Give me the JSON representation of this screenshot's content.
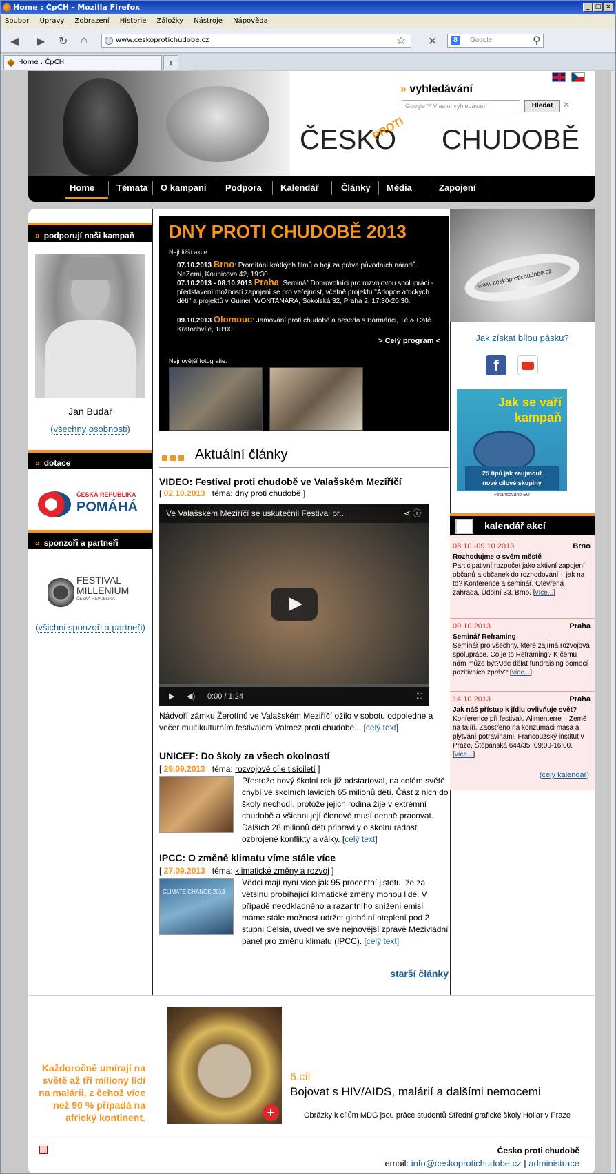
{
  "browser": {
    "title": "Home : ČpCH - Mozilla Firefox",
    "menu": [
      "Soubor",
      "Úpravy",
      "Zobrazení",
      "Historie",
      "Záložky",
      "Nástroje",
      "Nápověda"
    ],
    "url": "www.ceskoprotichudobe.cz",
    "search_placeholder": "Google",
    "tab_label": "Home : ČpCH",
    "newtab": "+"
  },
  "header": {
    "search_title": "vyhledávání",
    "search_placeholder": "Google™ Vlastní vyhledávání",
    "search_button": "Hledat",
    "logo_left": "ČESKO",
    "logo_mid": "PROTI",
    "logo_right": "CHUDOBĚ"
  },
  "nav": [
    "Home",
    "Témata",
    "O kampani",
    "Podpora",
    "Kalendář",
    "Články",
    "Média",
    "Zapojení"
  ],
  "left": {
    "support_title": "podporují naši kampaň",
    "person_name": "Jan Budař",
    "all_persons": "všechny osobnosti",
    "dotace_title": "dotace",
    "pomaha_top": "ČESKÁ REPUBLIKA",
    "pomaha_bottom": "POMÁHÁ",
    "sponsors_title": "sponzoři a partneři",
    "millenium_name": "FESTIVAL MILLENIUM",
    "millenium_sub": "ČESKÁ REPUBLIKA",
    "all_sponsors": "všichni sponzoři a partneři"
  },
  "promo": {
    "title": "DNY PROTI CHUDOBĚ 2013",
    "nearest": "Nejbližší akce:",
    "events": [
      {
        "date": "07.10.2013",
        "city": "Brno",
        "text": ": Promítání krátkých filmů o boji za práva původních národů. NaZemi, Kounicova 42, 19:30."
      },
      {
        "date": "07.10.2013 - 08.10.2013",
        "city": "Praha",
        "text": ": Seminář Dobrovolníci pro rozvojovou spolupráci - představení možností zapojení se pro veřejnost, včetně projektu \"Adopce afrických dětí\" a projektů v Guinei. WONTANARA, Sokolská 32, Praha 2, 17:30-20:30."
      },
      {
        "date": "09.10.2013",
        "city": "Olomouc",
        "text": ": Jamování proti chudobě a beseda s Barmánci, Té & Café Kratochvíle, 18:00."
      }
    ],
    "program": "> Celý program <",
    "photos": "Nejnovější fotografie:"
  },
  "articles": {
    "section": "Aktuální články",
    "items": [
      {
        "title": "VIDEO: Festival proti chudobě ve Valašském Meziříčí",
        "date": "02.10.2013",
        "topic_label": "téma:",
        "topic": "dny proti chudobě",
        "video_title": "Ve Valašském Meziříčí se uskutečnil Festival pr...",
        "video_time": "0:00 / 1:24",
        "text": "Nádvoří zámku Žerotínů ve Valašském Meziříčí ožilo v sobotu odpoledne a večer multikulturním festivalem Valmez proti chudobě...",
        "more": "celý text"
      },
      {
        "title": "UNICEF: Do školy za všech okolností",
        "date": "29.09.2013",
        "topic_label": "téma:",
        "topic": "rozvojové cíle tisíciletí",
        "text": "Přestože nový školní rok již odstartoval, na celém světě chybí ve školních lavicích 65 milionů dětí. Část z nich do školy nechodí, protože jejich rodina žije v extrémní chudobě a všichni její členové musí denně pracovat. Dalších 28 milionů dětí připravily o školní radosti ozbrojené konflikty a války.",
        "more": "celý text"
      },
      {
        "title": "IPCC: O změně klimatu víme stále více",
        "date": "27.09.2013",
        "topic_label": "téma:",
        "topic": "klimatické změny a rozvoj",
        "thumb_text": "CLIMATE CHANGE 2013",
        "text": "Vědci mají nyní více jak 95 procentní jistotu, že za většinu probíhající klimatické změny mohou lidé. V případě neodkladného a razantního snížení emisí máme stále možnost udržet globální oteplení pod 2 stupni Celsia, uvedl ve své nejnovější zprávě Mezivládní panel pro změnu klimatu (IPCC).",
        "more": "celý text"
      }
    ],
    "older": "starší články"
  },
  "right": {
    "band_text": "www.ceskoprotichudobe.cz",
    "band_link": "Jak získat bílou pásku?",
    "ad_title": "Jak se vaří kampaň",
    "ad_line1": "25 tipů jak zaujmout",
    "ad_line2": "nové cílové skupiny",
    "ad_eu": "Financováno EU",
    "calendar_title": "kalendář akcí",
    "events": [
      {
        "date": "08.10.-09.10.2013",
        "place": "Brno",
        "name": "Rozhodujme o svém městě",
        "text": "Participativní rozpočet jako aktivní zapojení občanů a občanek do rozhodování – jak na to? Konference a seminář, Otevřená zahrada, Údolní 33, Brno.",
        "more": "více..."
      },
      {
        "date": "09.10.2013",
        "place": "Praha",
        "name": "Seminář Reframing",
        "text": "Seminář pro všechny, které zajímá rozvojová spolupráce. Co je to Reframing? K čemu nám může být?Jde dělat fundraising pomocí pozitivních zpráv?",
        "more": "více..."
      },
      {
        "date": "14.10.2013",
        "place": "Praha",
        "name": "Jak náš přístup k jídlu ovlivňuje svět?",
        "text": "Konference při festivalu Alimenterre – Země na talíři. Zaostřeno na konzumaci masa a plýtvání potravinami. Francouzský institut v Praze, Štěpánská 644/35, 09:00-16:00.",
        "more": "více..."
      }
    ],
    "all_calendar": "celý kalendář"
  },
  "bottom": {
    "left_text": "Každoročně umírají na světě až tři miliony lidí na malárii, z čehož více než 90 % případá na africký kontinent.",
    "goal_num": "6.cíl",
    "goal": "Bojovat s HIV/AIDS, malárií a dalšími nemocemi",
    "credit": "Obrázky k cílům MDG jsou práce studentů Střední grafické školy Hollar v Praze"
  },
  "footer": {
    "org": "Česko proti chudobě",
    "email_label": "email:",
    "email": "info@ceskoprotichudobe.cz",
    "sep": "|",
    "admin": "administrace"
  }
}
